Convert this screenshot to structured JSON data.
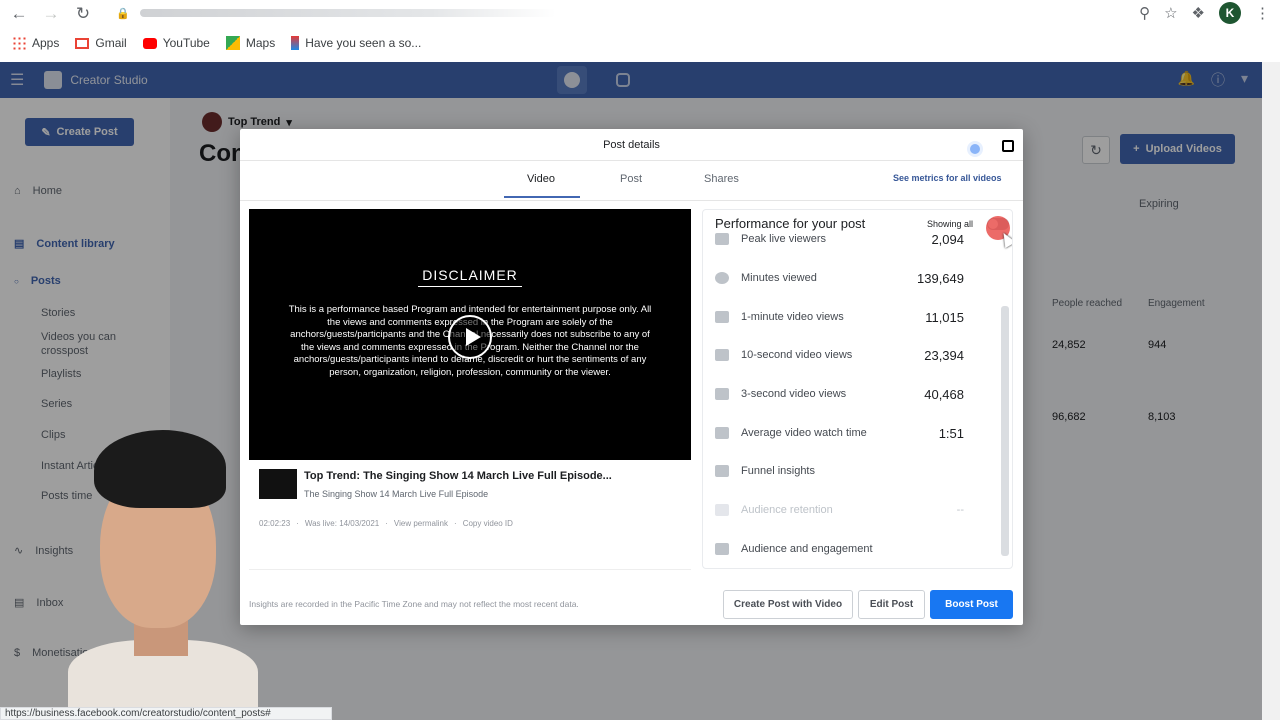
{
  "browser": {
    "bookmarks": [
      "Apps",
      "Gmail",
      "YouTube",
      "Maps",
      "Have you seen a so..."
    ],
    "profile_initial": "K",
    "status_url": "https://business.facebook.com/creatorstudio/content_posts#"
  },
  "studio": {
    "title": "Creator Studio",
    "create_post": "Create Post",
    "page_name": "Top Trend",
    "page_title": "Con",
    "upload_videos": "Upload Videos",
    "sidebar": {
      "home": "Home",
      "content_library": "Content library",
      "posts": "Posts",
      "stories": "Stories",
      "videos_crosspost": "Videos you can crosspost",
      "playlists": "Playlists",
      "series": "Series",
      "clips": "Clips",
      "instant_articles": "Instant Articles",
      "posts_timeline": "Posts time",
      "insights": "Insights",
      "inbox": "Inbox",
      "monetisation": "Monetisation"
    },
    "table": {
      "col_expiring": "Expiring",
      "col_people_reached": "People reached",
      "col_engagement": "Engagement",
      "rows": [
        {
          "reached": "24,852",
          "engagement": "944"
        },
        {
          "reached": "96,682",
          "engagement": "8,103"
        }
      ]
    }
  },
  "modal": {
    "title": "Post details",
    "tabs": [
      "Video",
      "Post",
      "Shares"
    ],
    "active_tab": "Video",
    "see_metrics": "See metrics for all videos",
    "video": {
      "disclaimer_title": "DISCLAIMER",
      "disclaimer_text": "This is a performance based Program and intended for entertainment purpose only. All the views and comments expressed in the Program are solely of the anchors/guests/participants and the Channel necessarily does not subscribe to any of the views and comments expressed in the Program. Neither the Channel nor the anchors/guests/participants intend to defame, discredit or hurt the sentiments of any person, organization, religion, profession, community or the viewer.",
      "title": "Top Trend: The Singing Show 14 March Live Full Episode...",
      "subtitle": "The Singing Show 14 March Live Full Episode",
      "duration": "02:02:23",
      "was_live": "Was live: 14/03/2021",
      "view_permalink": "View permalink",
      "copy_video_id": "Copy video ID"
    },
    "performance": {
      "header": "Performance for your post",
      "showing_all": "Showing all",
      "metrics": [
        {
          "label": "Peak live viewers",
          "value": "2,094",
          "icon": "people-icon"
        },
        {
          "label": "Minutes viewed",
          "value": "139,649",
          "icon": "clock-icon"
        },
        {
          "label": "1-minute video views",
          "value": "11,015",
          "icon": "video-camera-icon"
        },
        {
          "label": "10-second video views",
          "value": "23,394",
          "icon": "video-camera-icon"
        },
        {
          "label": "3-second video views",
          "value": "40,468",
          "icon": "video-camera-icon"
        },
        {
          "label": "Average video watch time",
          "value": "1:51",
          "icon": "film-icon"
        },
        {
          "label": "Funnel insights",
          "value": "",
          "icon": "funnel-icon"
        },
        {
          "label": "Audience retention",
          "value": "--",
          "icon": "retention-icon"
        },
        {
          "label": "Audience and engagement",
          "value": "",
          "icon": "audience-icon"
        }
      ]
    },
    "footer_note": "Insights are recorded in the Pacific Time Zone and may not reflect the most recent data.",
    "buttons": {
      "create_post_with_video": "Create Post with Video",
      "edit_post": "Edit Post",
      "boost_post": "Boost Post"
    }
  },
  "colors": {
    "header_blue": "#4267b2",
    "boost_blue": "#1877f2",
    "cursor_highlight": "#e53935"
  }
}
